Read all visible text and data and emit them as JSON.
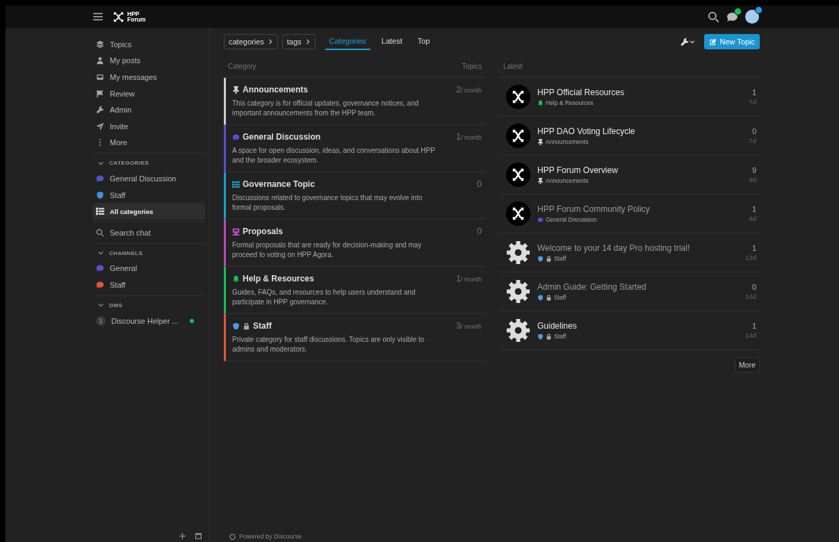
{
  "header": {
    "logo": {
      "line_1": "HPP",
      "line_2": "Forum"
    }
  },
  "sidebar": {
    "sections": [
      {
        "items": [
          {
            "kind": "layers",
            "label": "Topics",
            "selected": false
          },
          {
            "kind": "user",
            "label": "My posts",
            "selected": false
          },
          {
            "kind": "inbox",
            "label": "My messages",
            "selected": false
          },
          {
            "kind": "flag",
            "label": "Review",
            "selected": false
          },
          {
            "kind": "wrench",
            "label": "Admin",
            "selected": false
          },
          {
            "kind": "send",
            "label": "Invite",
            "selected": false
          },
          {
            "kind": "dots",
            "label": "More",
            "selected": false
          }
        ]
      },
      {
        "title": "CATEGORIES",
        "expanded": true,
        "items": [
          {
            "kind": "chat",
            "color": "#5b4fcf",
            "label": "General Discussion",
            "selected": false
          },
          {
            "kind": "shield",
            "color": "#3f8fd8",
            "label": "Staff",
            "selected": false
          },
          {
            "kind": "list",
            "label": "All categories",
            "selected": true
          }
        ]
      },
      {
        "items": [
          {
            "kind": "search",
            "label": "Search chat",
            "selected": false
          }
        ]
      },
      {
        "title": "CHANNELS",
        "expanded": true,
        "items": [
          {
            "kind": "chat",
            "color": "#5b4fcf",
            "label": "General",
            "selected": false
          },
          {
            "kind": "chat",
            "color": "#e45735",
            "label": "Staff",
            "selected": false
          }
        ]
      },
      {
        "title": "DMS",
        "expanded": true,
        "items": [
          {
            "kind": "dm",
            "badge": "1",
            "label": "Discourse Helper ...",
            "online": true,
            "selected": false
          }
        ]
      }
    ]
  },
  "nav": {
    "breadcrumbs": [
      "categories",
      "tags"
    ],
    "tabs": [
      {
        "label": "Categories",
        "selected": true
      },
      {
        "label": "Latest",
        "selected": false
      },
      {
        "label": "Top",
        "selected": false
      }
    ],
    "new_topic_button": "New Topic"
  },
  "categories": {
    "columns": {
      "category": "Category",
      "topics": "Topics"
    },
    "rows": [
      {
        "color": "#cfcfcf",
        "icons": [
          {
            "kind": "pin",
            "color": "#cfcfcf"
          }
        ],
        "name": "Announcements",
        "description": "This category is for official updates, governance notices, and important announcements from the HPP team.",
        "count": "2",
        "period": "/ month"
      },
      {
        "color": "#5b4fcf",
        "icons": [
          {
            "kind": "chat",
            "color": "#5b4fcf"
          }
        ],
        "name": "General Discussion",
        "description": "A space for open discussion, ideas, and conversations about HPP and the broader ecosystem.",
        "count": "1",
        "period": "/ month"
      },
      {
        "color": "#14a3c7",
        "icons": [
          {
            "kind": "list",
            "color": "#14a3c7"
          }
        ],
        "name": "Governance Topic",
        "description": "Discussions related to governance topics that may evolve into formal proposals.",
        "count": "0"
      },
      {
        "color": "#b64ac2",
        "icons": [
          {
            "kind": "podium",
            "color": "#b64ac2"
          }
        ],
        "name": "Proposals",
        "description": "Formal proposals that are ready for decision-making and may proceed to voting on HPP Agora.",
        "count": "0"
      },
      {
        "color": "#15c156",
        "icons": [
          {
            "kind": "bell",
            "color": "#15c156"
          }
        ],
        "name": "Help & Resources",
        "description": "Guides, FAQs, and resources to help users understand and participate in HPP governance.",
        "count": "1",
        "period": "/ month"
      },
      {
        "color": "#e45735",
        "icons": [
          {
            "kind": "shield",
            "color": "#4f9be0"
          },
          {
            "kind": "lock",
            "color": "#aaaaaa"
          }
        ],
        "name": "Staff",
        "description": "Private category for staff discussions. Topics are only visible to admins and moderators.",
        "count": "3",
        "period": "/ month"
      }
    ]
  },
  "latest": {
    "heading": "Latest",
    "topics": [
      {
        "kind": "logo",
        "title": "HPP Official Resources",
        "visited": false,
        "category": "Help & Resources",
        "icons": [
          {
            "kind": "bell",
            "color": "#15c156"
          }
        ],
        "replies": "1",
        "age": "7d"
      },
      {
        "kind": "logo",
        "title": "HPP DAO Voting Lifecycle",
        "visited": false,
        "category": "Announcements",
        "icons": [
          {
            "kind": "pin",
            "color": "#cfcfcf"
          }
        ],
        "replies": "0",
        "age": "7d"
      },
      {
        "kind": "logo",
        "title": "HPP Forum Overview",
        "visited": false,
        "category": "Announcements",
        "icons": [
          {
            "kind": "pin",
            "color": "#cfcfcf"
          }
        ],
        "replies": "9",
        "age": "8d"
      },
      {
        "kind": "logo",
        "title": "HPP Forum Community Policy",
        "visited": true,
        "category": "General Discussion",
        "icons": [
          {
            "kind": "chat",
            "color": "#5b4fcf"
          }
        ],
        "replies": "1",
        "age": "8d"
      },
      {
        "kind": "gear",
        "title": "Welcome to your 14 day Pro hosting trial!",
        "visited": true,
        "category": "Staff",
        "icons": [
          {
            "kind": "shield",
            "color": "#4f9be0"
          },
          {
            "kind": "lock",
            "color": "#aaaaaa"
          }
        ],
        "replies": "1",
        "age": "13d"
      },
      {
        "kind": "gear",
        "title": "Admin Guide: Getting Started",
        "visited": true,
        "category": "Staff",
        "icons": [
          {
            "kind": "shield",
            "color": "#4f9be0"
          },
          {
            "kind": "lock",
            "color": "#aaaaaa"
          }
        ],
        "replies": "0",
        "age": "14d"
      },
      {
        "kind": "gear",
        "title": "Guidelines",
        "visited": false,
        "category": "Staff",
        "icons": [
          {
            "kind": "shield",
            "color": "#4f9be0"
          },
          {
            "kind": "lock",
            "color": "#aaaaaa"
          }
        ],
        "replies": "1",
        "age": "14d"
      }
    ],
    "more_button": "More"
  },
  "footer": {
    "text": "Powered by Discourse"
  }
}
